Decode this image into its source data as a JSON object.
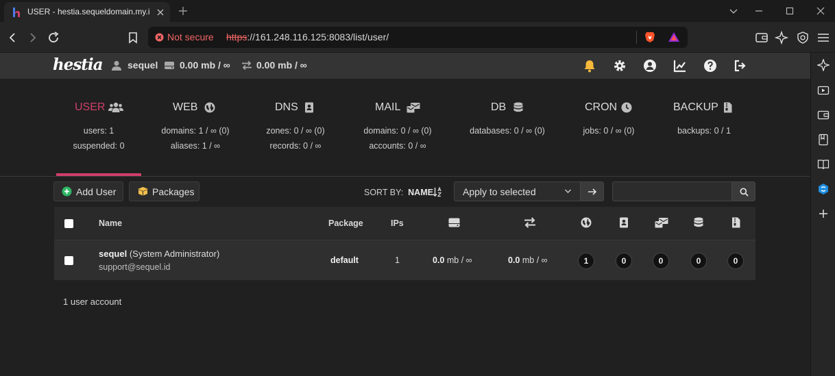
{
  "browser": {
    "tab_title": "USER - hestia.sequeldomain.my.id",
    "security_label": "Not secure",
    "url_scheme": "https",
    "url_rest": "://161.248.116.125:8083/list/user/"
  },
  "header": {
    "logo": "hestia",
    "username": "sequel",
    "disk_usage": "0.00 mb / ∞",
    "bandwidth_usage": "0.00 mb / ∞"
  },
  "stats": [
    {
      "title": "USER",
      "active": true,
      "lines": [
        "users: 1",
        "suspended: 0"
      ],
      "icon": "users-icon"
    },
    {
      "title": "WEB",
      "active": false,
      "lines": [
        "domains: 1 / ∞ (0)",
        "aliases: 1 / ∞"
      ],
      "icon": "globe-icon"
    },
    {
      "title": "DNS",
      "active": false,
      "lines": [
        "zones: 0 / ∞ (0)",
        "records: 0 / ∞"
      ],
      "icon": "address-book-icon"
    },
    {
      "title": "MAIL",
      "active": false,
      "lines": [
        "domains: 0 / ∞ (0)",
        "accounts: 0 / ∞"
      ],
      "icon": "mail-bulk-icon"
    },
    {
      "title": "DB",
      "active": false,
      "lines": [
        "databases: 0 / ∞ (0)"
      ],
      "icon": "database-icon"
    },
    {
      "title": "CRON",
      "active": false,
      "lines": [
        "jobs: 0 / ∞ (0)"
      ],
      "icon": "clock-icon"
    },
    {
      "title": "BACKUP",
      "active": false,
      "lines": [
        "backups: 0 / 1"
      ],
      "icon": "file-zipper-icon"
    }
  ],
  "actions": {
    "add_user": "Add User",
    "packages": "Packages",
    "sort_by_label": "SORT BY:",
    "sort_by_value": "NAME",
    "bulk_action": "Apply to selected",
    "search_placeholder": ""
  },
  "table": {
    "headers": {
      "name": "Name",
      "package": "Package",
      "ips": "IPs"
    },
    "rows": [
      {
        "username": "sequel",
        "role": "(System Administrator)",
        "email": "support@sequel.id",
        "package": "default",
        "ips": "1",
        "disk_value": "0.0",
        "disk_unit": "mb / ∞",
        "bw_value": "0.0",
        "bw_unit": "mb / ∞",
        "web": "1",
        "dns": "0",
        "mail": "0",
        "db": "0",
        "backup": "0"
      }
    ]
  },
  "footer": {
    "count": "1 user account"
  },
  "colors": {
    "accent": "#d13e6c",
    "not_secure": "#f16565",
    "bell": "#f5b93b",
    "add_icon": "#2fb566",
    "packages_icon": "#f3c04c"
  }
}
